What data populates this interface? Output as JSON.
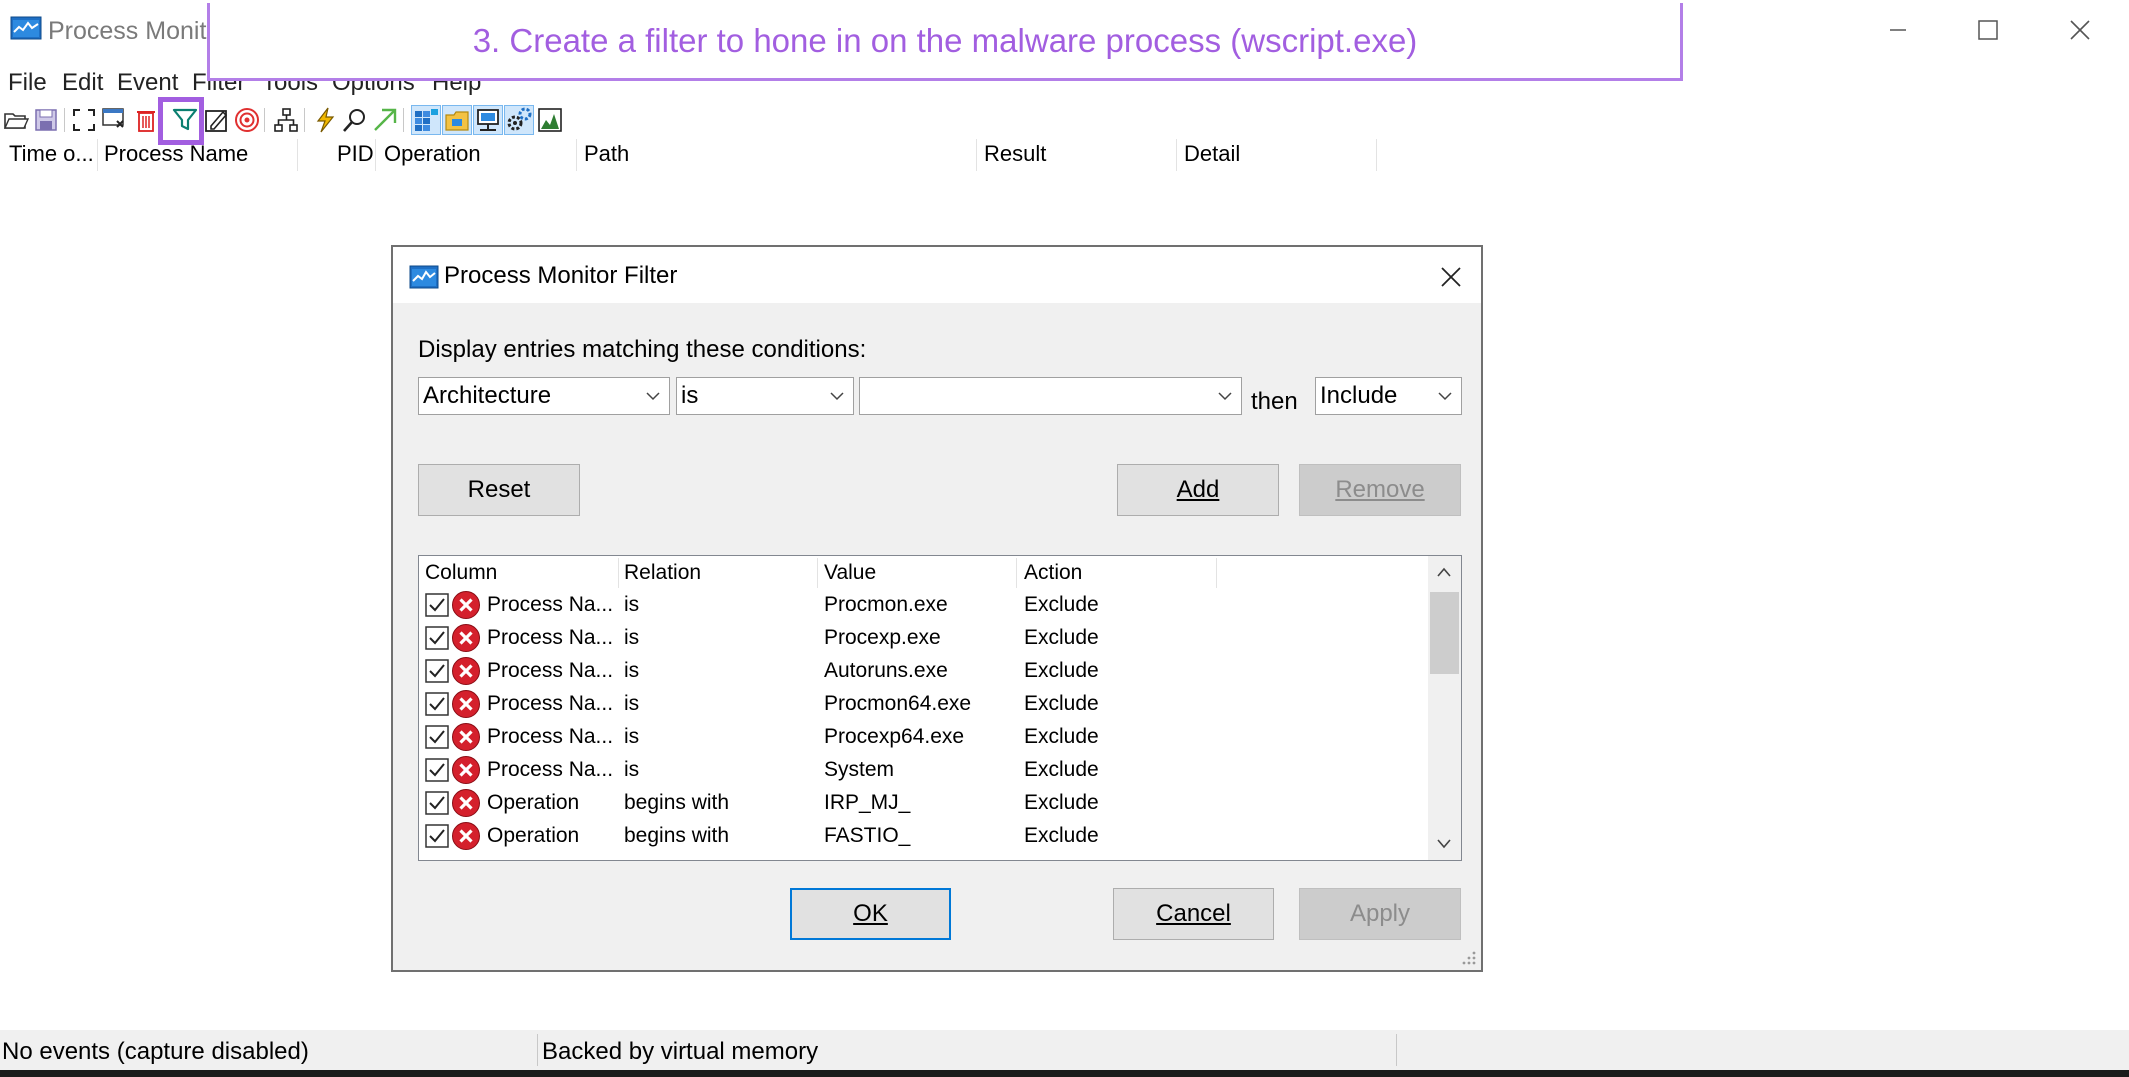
{
  "window": {
    "title": "Process Monito",
    "menu": [
      "File",
      "Edit",
      "Event",
      "Filter",
      "Tools",
      "Options",
      "Help"
    ]
  },
  "annotation": {
    "text": "3. Create a filter to hone in on the malware process (wscript.exe)",
    "color": "#a25ee0"
  },
  "columns": [
    "Time o...",
    "Process Name",
    "PID",
    "Operation",
    "Path",
    "Result",
    "Detail"
  ],
  "toolbar_icons": [
    "open-icon",
    "save-icon",
    "autoscroll-icon",
    "capture-icon",
    "clear-icon",
    "filter-icon",
    "highlight-icon",
    "target-icon",
    "process-tree-icon",
    "event-properties-icon",
    "find-icon",
    "jump-to-icon",
    "registry-icon",
    "file-system-icon",
    "network-icon",
    "process-thread-icon",
    "profiling-icon"
  ],
  "dialog": {
    "title": "Process Monitor Filter",
    "prompt": "Display entries matching these conditions:",
    "column_select": "Architecture",
    "relation_select": "is",
    "value_input": "",
    "then_label": "then",
    "action_select": "Include",
    "reset_button": "Reset",
    "add_button": "Add",
    "remove_button": "Remove",
    "ok_button": "OK",
    "cancel_button": "Cancel",
    "apply_button": "Apply",
    "list_headers": [
      "Column",
      "Relation",
      "Value",
      "Action"
    ],
    "rows": [
      {
        "column": "Process Na...",
        "relation": "is",
        "value": "Procmon.exe",
        "action": "Exclude"
      },
      {
        "column": "Process Na...",
        "relation": "is",
        "value": "Procexp.exe",
        "action": "Exclude"
      },
      {
        "column": "Process Na...",
        "relation": "is",
        "value": "Autoruns.exe",
        "action": "Exclude"
      },
      {
        "column": "Process Na...",
        "relation": "is",
        "value": "Procmon64.exe",
        "action": "Exclude"
      },
      {
        "column": "Process Na...",
        "relation": "is",
        "value": "Procexp64.exe",
        "action": "Exclude"
      },
      {
        "column": "Process Na...",
        "relation": "is",
        "value": "System",
        "action": "Exclude"
      },
      {
        "column": "Operation",
        "relation": "begins with",
        "value": "IRP_MJ_",
        "action": "Exclude"
      },
      {
        "column": "Operation",
        "relation": "begins with",
        "value": "FASTIO_",
        "action": "Exclude"
      }
    ]
  },
  "status": {
    "events": "No events (capture disabled)",
    "memory": "Backed by virtual memory"
  }
}
